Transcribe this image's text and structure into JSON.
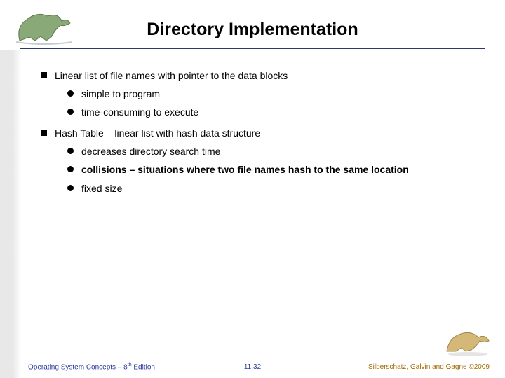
{
  "title": "Directory Implementation",
  "bullets": {
    "b1": "Linear list of file names with pointer to the data blocks",
    "b1a": "simple to program",
    "b1b": "time-consuming to execute",
    "b2": "Hash Table – linear list with hash data structure",
    "b2a": "decreases directory search time",
    "b2b_strong": "collisions",
    "b2b_rest": " – situations where two file names hash to the same location",
    "b2c": "fixed size"
  },
  "footer": {
    "left_a": "Operating System Concepts – 8",
    "left_sup": "th",
    "left_b": " Edition",
    "mid": "11.32",
    "right": "Silberschatz, Galvin and Gagne ©2009"
  }
}
